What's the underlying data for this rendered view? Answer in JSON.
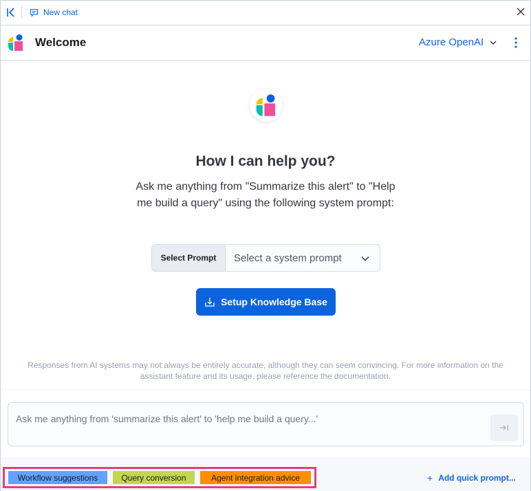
{
  "topbar": {
    "new_chat_label": "New chat"
  },
  "header": {
    "title": "Welcome",
    "connector": "Azure OpenAI"
  },
  "welcome": {
    "heading": "How I can help you?",
    "description": "Ask me anything from \"Summarize this alert\" to \"Help me build a query\" using the following system prompt:"
  },
  "prompt_select": {
    "label": "Select Prompt",
    "placeholder": "Select a system prompt"
  },
  "kb_button": {
    "label": "Setup Knowledge Base"
  },
  "disclaimer": "Responses from AI systems may not always be entirely accurate, although they can seem convincing. For more information on the assistant feature and its usage, please reference the documentation.",
  "chat_input": {
    "placeholder": "Ask me anything from 'summarize this alert' to 'help me build a query...'"
  },
  "quick_prompts": [
    {
      "label": "Workflow suggestions",
      "color": "#61a2ff"
    },
    {
      "label": "Query conversion",
      "color": "#c2d64f"
    },
    {
      "label": "Agent integration advice",
      "color": "#ff8e00"
    }
  ],
  "add_quick_prompt": "Add quick prompt...",
  "colors": {
    "accent": "#0b64dd",
    "highlight_border": "#e0407d",
    "logo_yellow": "#f5c000",
    "logo_teal": "#00bfb3",
    "logo_blue": "#0b64dd",
    "logo_pink": "#f04e98"
  }
}
